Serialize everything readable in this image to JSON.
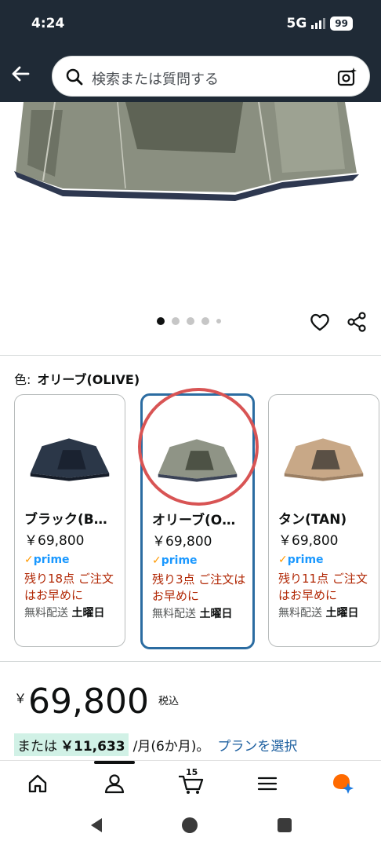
{
  "status": {
    "time": "4:24",
    "network": "5G",
    "battery": "99"
  },
  "search": {
    "placeholder": "検索または質問する"
  },
  "gallery": {
    "dots_total": 5,
    "active_index": 0
  },
  "color_selector": {
    "label": "色:",
    "selected_value": "オリーブ(OLIVE)",
    "options": [
      {
        "name": "ブラック(B…",
        "price": "￥69,800",
        "prime": "prime",
        "stock": "残り18点 ご注文はお早めに",
        "ship_prefix": "無料配送 ",
        "ship_day": "土曜日",
        "color": "#2b3748"
      },
      {
        "name": "オリーブ(O…",
        "price": "￥69,800",
        "prime": "prime",
        "stock": "残り3点 ご注文はお早めに",
        "ship_prefix": "無料配送 ",
        "ship_day": "土曜日",
        "color": "#8f9486"
      },
      {
        "name": "タン(TAN)",
        "price": "￥69,800",
        "prime": "prime",
        "stock": "残り11点 ご注文はお早めに",
        "ship_prefix": "無料配送 ",
        "ship_day": "土曜日",
        "color": "#c8a887"
      }
    ]
  },
  "price": {
    "currency": "￥",
    "amount": "69,800",
    "tax_label": "税込"
  },
  "installment": {
    "prefix": "または",
    "amount": "￥11,633",
    "period": "/月(6か月)。",
    "plan_link": "プランを選択"
  },
  "bottom_nav": {
    "cart_count": "15"
  },
  "colors": {
    "header_bg": "#1f2a36",
    "selected_border": "#2b6ca1",
    "stock_red": "#b12704",
    "link_blue": "#2162a1",
    "prime_blue": "#1a98ff",
    "highlight_green": "#d1f1e6"
  }
}
